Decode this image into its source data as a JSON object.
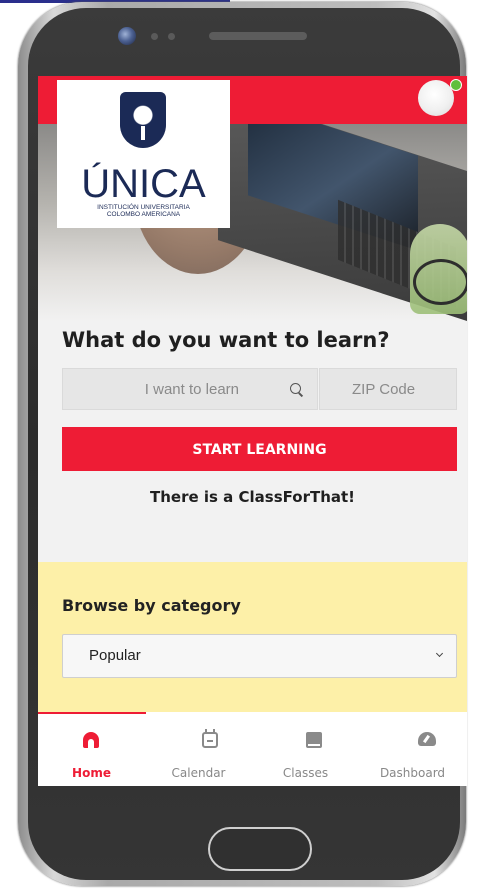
{
  "logo": {
    "wordmark": "ÚNICA",
    "subtitle_line1": "INSTITUCIÓN UNIVERSITARIA",
    "subtitle_line2": "COLOMBO AMERICANA"
  },
  "search": {
    "headline": "What do you want to learn?",
    "learn_placeholder": "I want to learn",
    "zip_placeholder": "ZIP Code",
    "cta_label": "START LEARNING",
    "tagline": "There is a ClassForThat!"
  },
  "browse": {
    "title": "Browse by category",
    "selected": "Popular"
  },
  "tabs": [
    {
      "label": "Home",
      "icon": "home-icon",
      "active": true
    },
    {
      "label": "Calendar",
      "icon": "calendar-icon",
      "active": false
    },
    {
      "label": "Classes",
      "icon": "book-icon",
      "active": false
    },
    {
      "label": "Dashboard",
      "icon": "dashboard-icon",
      "active": false
    }
  ],
  "colors": {
    "brand_red": "#ee1c35",
    "banner_yellow": "#fdf0a8",
    "logo_navy": "#1b2a56",
    "online_green": "#5fbf3c"
  }
}
